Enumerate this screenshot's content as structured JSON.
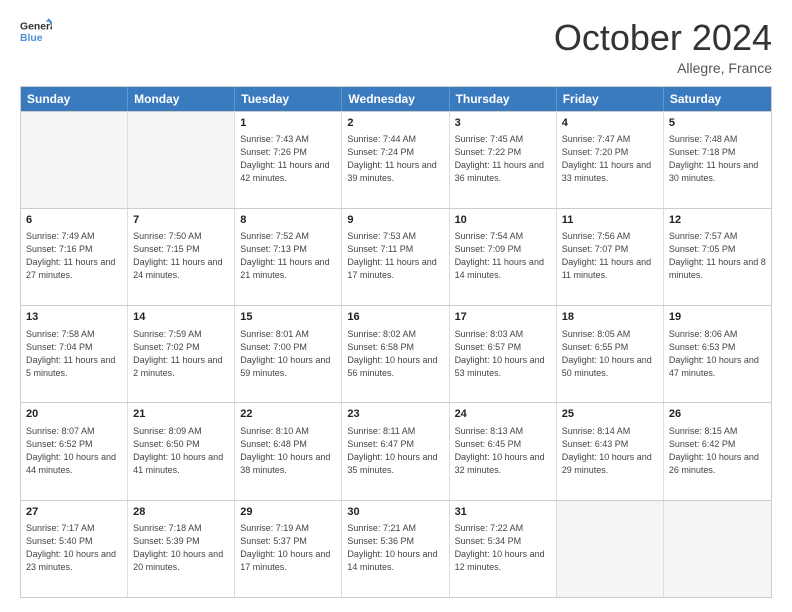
{
  "header": {
    "logo_line1": "General",
    "logo_line2": "Blue",
    "month": "October 2024",
    "location": "Allegre, France"
  },
  "days_of_week": [
    "Sunday",
    "Monday",
    "Tuesday",
    "Wednesday",
    "Thursday",
    "Friday",
    "Saturday"
  ],
  "weeks": [
    [
      {
        "day": "",
        "sunrise": "",
        "sunset": "",
        "daylight": "",
        "empty": true
      },
      {
        "day": "",
        "sunrise": "",
        "sunset": "",
        "daylight": "",
        "empty": true
      },
      {
        "day": "1",
        "sunrise": "Sunrise: 7:43 AM",
        "sunset": "Sunset: 7:26 PM",
        "daylight": "Daylight: 11 hours and 42 minutes.",
        "empty": false
      },
      {
        "day": "2",
        "sunrise": "Sunrise: 7:44 AM",
        "sunset": "Sunset: 7:24 PM",
        "daylight": "Daylight: 11 hours and 39 minutes.",
        "empty": false
      },
      {
        "day": "3",
        "sunrise": "Sunrise: 7:45 AM",
        "sunset": "Sunset: 7:22 PM",
        "daylight": "Daylight: 11 hours and 36 minutes.",
        "empty": false
      },
      {
        "day": "4",
        "sunrise": "Sunrise: 7:47 AM",
        "sunset": "Sunset: 7:20 PM",
        "daylight": "Daylight: 11 hours and 33 minutes.",
        "empty": false
      },
      {
        "day": "5",
        "sunrise": "Sunrise: 7:48 AM",
        "sunset": "Sunset: 7:18 PM",
        "daylight": "Daylight: 11 hours and 30 minutes.",
        "empty": false
      }
    ],
    [
      {
        "day": "6",
        "sunrise": "Sunrise: 7:49 AM",
        "sunset": "Sunset: 7:16 PM",
        "daylight": "Daylight: 11 hours and 27 minutes.",
        "empty": false
      },
      {
        "day": "7",
        "sunrise": "Sunrise: 7:50 AM",
        "sunset": "Sunset: 7:15 PM",
        "daylight": "Daylight: 11 hours and 24 minutes.",
        "empty": false
      },
      {
        "day": "8",
        "sunrise": "Sunrise: 7:52 AM",
        "sunset": "Sunset: 7:13 PM",
        "daylight": "Daylight: 11 hours and 21 minutes.",
        "empty": false
      },
      {
        "day": "9",
        "sunrise": "Sunrise: 7:53 AM",
        "sunset": "Sunset: 7:11 PM",
        "daylight": "Daylight: 11 hours and 17 minutes.",
        "empty": false
      },
      {
        "day": "10",
        "sunrise": "Sunrise: 7:54 AM",
        "sunset": "Sunset: 7:09 PM",
        "daylight": "Daylight: 11 hours and 14 minutes.",
        "empty": false
      },
      {
        "day": "11",
        "sunrise": "Sunrise: 7:56 AM",
        "sunset": "Sunset: 7:07 PM",
        "daylight": "Daylight: 11 hours and 11 minutes.",
        "empty": false
      },
      {
        "day": "12",
        "sunrise": "Sunrise: 7:57 AM",
        "sunset": "Sunset: 7:05 PM",
        "daylight": "Daylight: 11 hours and 8 minutes.",
        "empty": false
      }
    ],
    [
      {
        "day": "13",
        "sunrise": "Sunrise: 7:58 AM",
        "sunset": "Sunset: 7:04 PM",
        "daylight": "Daylight: 11 hours and 5 minutes.",
        "empty": false
      },
      {
        "day": "14",
        "sunrise": "Sunrise: 7:59 AM",
        "sunset": "Sunset: 7:02 PM",
        "daylight": "Daylight: 11 hours and 2 minutes.",
        "empty": false
      },
      {
        "day": "15",
        "sunrise": "Sunrise: 8:01 AM",
        "sunset": "Sunset: 7:00 PM",
        "daylight": "Daylight: 10 hours and 59 minutes.",
        "empty": false
      },
      {
        "day": "16",
        "sunrise": "Sunrise: 8:02 AM",
        "sunset": "Sunset: 6:58 PM",
        "daylight": "Daylight: 10 hours and 56 minutes.",
        "empty": false
      },
      {
        "day": "17",
        "sunrise": "Sunrise: 8:03 AM",
        "sunset": "Sunset: 6:57 PM",
        "daylight": "Daylight: 10 hours and 53 minutes.",
        "empty": false
      },
      {
        "day": "18",
        "sunrise": "Sunrise: 8:05 AM",
        "sunset": "Sunset: 6:55 PM",
        "daylight": "Daylight: 10 hours and 50 minutes.",
        "empty": false
      },
      {
        "day": "19",
        "sunrise": "Sunrise: 8:06 AM",
        "sunset": "Sunset: 6:53 PM",
        "daylight": "Daylight: 10 hours and 47 minutes.",
        "empty": false
      }
    ],
    [
      {
        "day": "20",
        "sunrise": "Sunrise: 8:07 AM",
        "sunset": "Sunset: 6:52 PM",
        "daylight": "Daylight: 10 hours and 44 minutes.",
        "empty": false
      },
      {
        "day": "21",
        "sunrise": "Sunrise: 8:09 AM",
        "sunset": "Sunset: 6:50 PM",
        "daylight": "Daylight: 10 hours and 41 minutes.",
        "empty": false
      },
      {
        "day": "22",
        "sunrise": "Sunrise: 8:10 AM",
        "sunset": "Sunset: 6:48 PM",
        "daylight": "Daylight: 10 hours and 38 minutes.",
        "empty": false
      },
      {
        "day": "23",
        "sunrise": "Sunrise: 8:11 AM",
        "sunset": "Sunset: 6:47 PM",
        "daylight": "Daylight: 10 hours and 35 minutes.",
        "empty": false
      },
      {
        "day": "24",
        "sunrise": "Sunrise: 8:13 AM",
        "sunset": "Sunset: 6:45 PM",
        "daylight": "Daylight: 10 hours and 32 minutes.",
        "empty": false
      },
      {
        "day": "25",
        "sunrise": "Sunrise: 8:14 AM",
        "sunset": "Sunset: 6:43 PM",
        "daylight": "Daylight: 10 hours and 29 minutes.",
        "empty": false
      },
      {
        "day": "26",
        "sunrise": "Sunrise: 8:15 AM",
        "sunset": "Sunset: 6:42 PM",
        "daylight": "Daylight: 10 hours and 26 minutes.",
        "empty": false
      }
    ],
    [
      {
        "day": "27",
        "sunrise": "Sunrise: 7:17 AM",
        "sunset": "Sunset: 5:40 PM",
        "daylight": "Daylight: 10 hours and 23 minutes.",
        "empty": false
      },
      {
        "day": "28",
        "sunrise": "Sunrise: 7:18 AM",
        "sunset": "Sunset: 5:39 PM",
        "daylight": "Daylight: 10 hours and 20 minutes.",
        "empty": false
      },
      {
        "day": "29",
        "sunrise": "Sunrise: 7:19 AM",
        "sunset": "Sunset: 5:37 PM",
        "daylight": "Daylight: 10 hours and 17 minutes.",
        "empty": false
      },
      {
        "day": "30",
        "sunrise": "Sunrise: 7:21 AM",
        "sunset": "Sunset: 5:36 PM",
        "daylight": "Daylight: 10 hours and 14 minutes.",
        "empty": false
      },
      {
        "day": "31",
        "sunrise": "Sunrise: 7:22 AM",
        "sunset": "Sunset: 5:34 PM",
        "daylight": "Daylight: 10 hours and 12 minutes.",
        "empty": false
      },
      {
        "day": "",
        "sunrise": "",
        "sunset": "",
        "daylight": "",
        "empty": true
      },
      {
        "day": "",
        "sunrise": "",
        "sunset": "",
        "daylight": "",
        "empty": true
      }
    ]
  ]
}
